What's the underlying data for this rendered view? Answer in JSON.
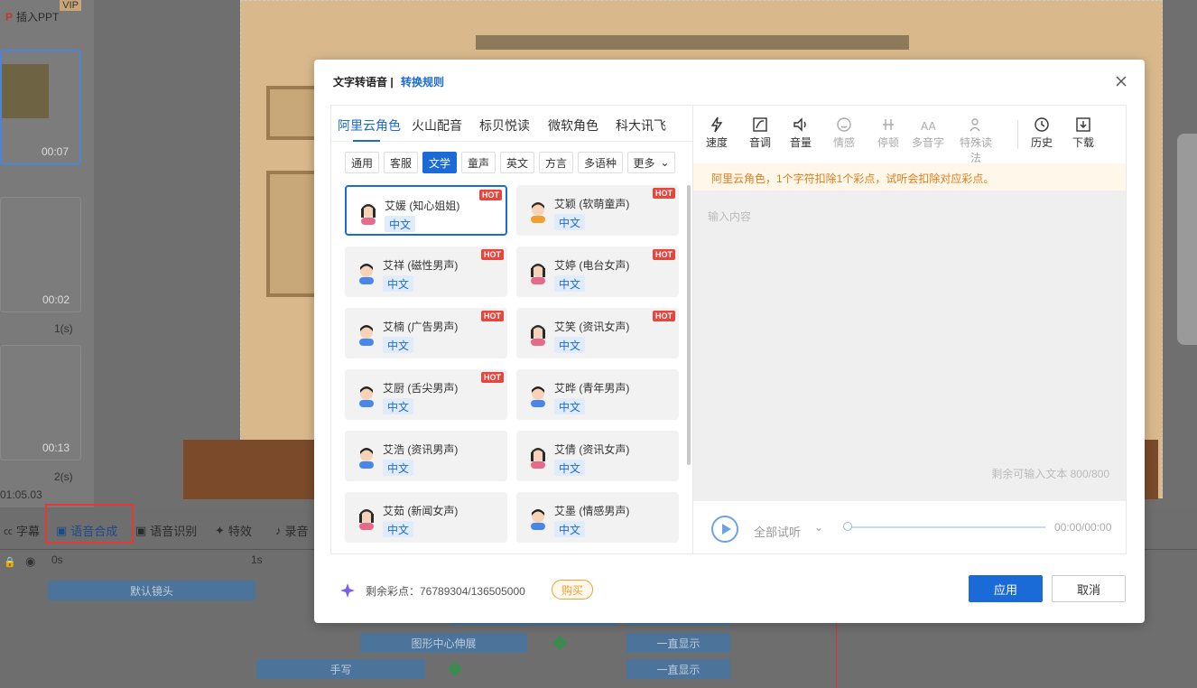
{
  "background": {
    "insert_ppt": "插入PPT",
    "vip": "VIP",
    "thumbs": [
      {
        "time": "00:07"
      },
      {
        "time": "00:02",
        "dur": "1(s)"
      },
      {
        "time": "00:13",
        "dur": "2(s)"
      }
    ],
    "total_time": "01:05.03",
    "bottom_tabs": [
      "字幕",
      "语音合成",
      "语音识别",
      "特效",
      "录音"
    ],
    "ruler": [
      "0s",
      "1s"
    ],
    "tracks": [
      "默认镜头",
      "图形中心伸展",
      "一直显示",
      "手写",
      "一直显示"
    ]
  },
  "dialog": {
    "title": "文字转语音 |",
    "rule_link": "转换规则",
    "vendor_tabs": [
      "阿里云角色",
      "火山配音",
      "标贝悦读",
      "微软角色",
      "科大讯飞"
    ],
    "categories": [
      "通用",
      "客服",
      "文学",
      "童声",
      "英文",
      "方言",
      "多语种",
      "更多"
    ],
    "voices": [
      {
        "name": "艾媛 (知心姐姐)",
        "lang": "中文",
        "hot": "HOT",
        "gender": "f"
      },
      {
        "name": "艾颖 (软萌童声)",
        "lang": "中文",
        "hot": "HOT",
        "gender": "c"
      },
      {
        "name": "艾祥 (磁性男声)",
        "lang": "中文",
        "hot": "HOT",
        "gender": "m"
      },
      {
        "name": "艾婷 (电台女声)",
        "lang": "中文",
        "hot": "HOT",
        "gender": "f"
      },
      {
        "name": "艾楠 (广告男声)",
        "lang": "中文",
        "hot": "HOT",
        "gender": "m"
      },
      {
        "name": "艾笑 (资讯女声)",
        "lang": "中文",
        "hot": "HOT",
        "gender": "f"
      },
      {
        "name": "艾厨 (舌尖男声)",
        "lang": "中文",
        "hot": "HOT",
        "gender": "m"
      },
      {
        "name": "艾晔 (青年男声)",
        "lang": "中文",
        "hot": "",
        "gender": "m"
      },
      {
        "name": "艾浩 (资讯男声)",
        "lang": "中文",
        "hot": "",
        "gender": "m"
      },
      {
        "name": "艾倩 (资讯女声)",
        "lang": "中文",
        "hot": "",
        "gender": "f"
      },
      {
        "name": "艾茹 (新闻女声)",
        "lang": "中文",
        "hot": "",
        "gender": "f"
      },
      {
        "name": "艾墨 (情感男声)",
        "lang": "中文",
        "hot": "",
        "gender": "m"
      }
    ],
    "tools": [
      {
        "label": "速度",
        "icon": "lightning-icon",
        "enabled": true
      },
      {
        "label": "音调",
        "icon": "pitch-icon",
        "enabled": true
      },
      {
        "label": "音量",
        "icon": "speaker-icon",
        "enabled": true
      },
      {
        "label": "情感",
        "icon": "smile-icon",
        "enabled": false
      },
      {
        "label": "停顿",
        "icon": "pause-icon",
        "enabled": false
      },
      {
        "label": "多音字",
        "icon": "polyphone-icon",
        "enabled": false
      },
      {
        "label": "特殊读法",
        "icon": "special-read-icon",
        "enabled": false
      },
      {
        "label": "历史",
        "icon": "history-icon",
        "enabled": true
      },
      {
        "label": "下载",
        "icon": "download-icon",
        "enabled": true
      }
    ],
    "notice": "阿里云角色，1个字符扣除1个彩点，试听会扣除对应彩点。",
    "input_placeholder": "输入内容",
    "remaining_text": "剩余可输入文本  800/800",
    "listen_all": "全部试听",
    "time": "00:00/00:00",
    "points": "剩余彩点：76789304/136505000",
    "buy": "购买",
    "apply": "应用",
    "cancel": "取消"
  }
}
